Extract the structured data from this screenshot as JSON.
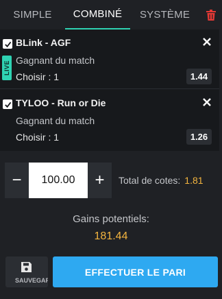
{
  "tabs": [
    {
      "label": "SIMPLE",
      "active": false
    },
    {
      "label": "COMBINÉ",
      "active": true
    },
    {
      "label": "SYSTÈME",
      "active": false
    }
  ],
  "trash_icon": "trash-icon",
  "colors": {
    "accent": "#2fd3b3",
    "odds_highlight": "#f4b53f",
    "primary_button": "#2ea9f1",
    "delete": "#e53935"
  },
  "bets": [
    {
      "checked": true,
      "match": "BLink - AGF",
      "market": "Gagnant du match",
      "choice": "Choisir : 1",
      "odds": "1.44",
      "live_badge": "LIVE"
    },
    {
      "checked": true,
      "match": "TYLOO - Run or Die",
      "market": "Gagnant du match",
      "choice": "Choisir : 1",
      "odds": "1.26"
    }
  ],
  "stake": {
    "minus": "−",
    "amount": "100.00",
    "plus": "+",
    "total_label": "Total de cotes:",
    "total_value": "1.81"
  },
  "gains": {
    "label": "Gains potentiels:",
    "value": "181.44"
  },
  "footer": {
    "save_label": "SAUVEGAR",
    "place_label": "EFFECTUER LE PARI"
  }
}
